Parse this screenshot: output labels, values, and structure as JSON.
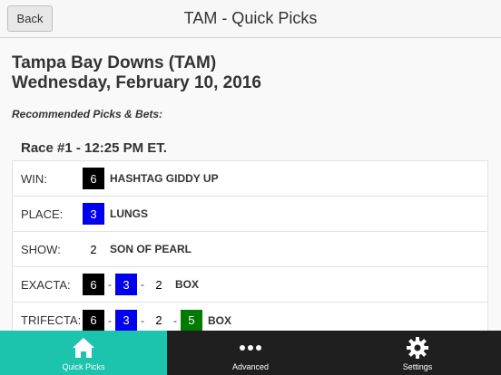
{
  "header": {
    "back_label": "Back",
    "title": "TAM - Quick Picks"
  },
  "track": {
    "name": "Tampa Bay Downs (TAM)",
    "date": "Wednesday, February 10, 2016"
  },
  "section_label": "Recommended Picks & Bets:",
  "race": {
    "title": "Race #1 - 12:25 PM ET."
  },
  "picks": [
    {
      "label": "WIN:",
      "numbers": [
        {
          "n": "6",
          "color": "black"
        }
      ],
      "horse": "HASHTAG GIDDY UP"
    },
    {
      "label": "PLACE:",
      "numbers": [
        {
          "n": "3",
          "color": "blue"
        }
      ],
      "horse": "LUNGS"
    },
    {
      "label": "SHOW:",
      "numbers": [
        {
          "n": "2",
          "color": "white"
        }
      ],
      "horse": "SON OF PEARL"
    },
    {
      "label": "EXACTA:",
      "numbers": [
        {
          "n": "6",
          "color": "black"
        },
        {
          "n": "3",
          "color": "blue"
        },
        {
          "n": "2",
          "color": "white"
        }
      ],
      "horse": "BOX"
    },
    {
      "label": "TRIFECTA:",
      "numbers": [
        {
          "n": "6",
          "color": "black"
        },
        {
          "n": "3",
          "color": "blue"
        },
        {
          "n": "2",
          "color": "white"
        },
        {
          "n": "5",
          "color": "green"
        }
      ],
      "horse": "BOX"
    }
  ],
  "tabs": [
    {
      "label": "Quick Picks",
      "icon": "home-icon",
      "active": true
    },
    {
      "label": "Advanced",
      "icon": "ellipsis-icon",
      "active": false
    },
    {
      "label": "Settings",
      "icon": "gear-icon",
      "active": false
    }
  ],
  "colors": {
    "tab_active": "#1cc4ae",
    "tab_inactive": "#1f1f1f",
    "saddle_black": "#000000",
    "saddle_blue": "#0000ee",
    "saddle_white": "#ffffff",
    "saddle_green": "#007a00"
  }
}
